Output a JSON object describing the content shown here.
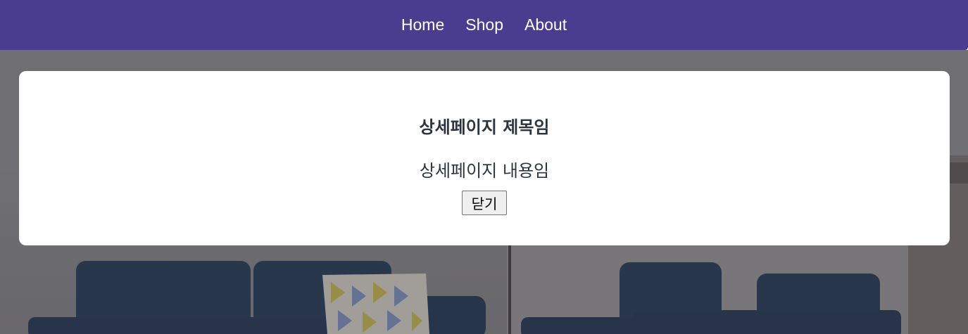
{
  "nav": {
    "items": [
      {
        "label": "Home"
      },
      {
        "label": "Shop"
      },
      {
        "label": "About"
      }
    ]
  },
  "modal": {
    "title": "상세페이지 제목임",
    "body": "상세페이지 내용임",
    "close_label": "닫기"
  },
  "colors": {
    "navbar": "#4a3d8f",
    "sofa": "#1f3553",
    "text": "#2c3440"
  }
}
